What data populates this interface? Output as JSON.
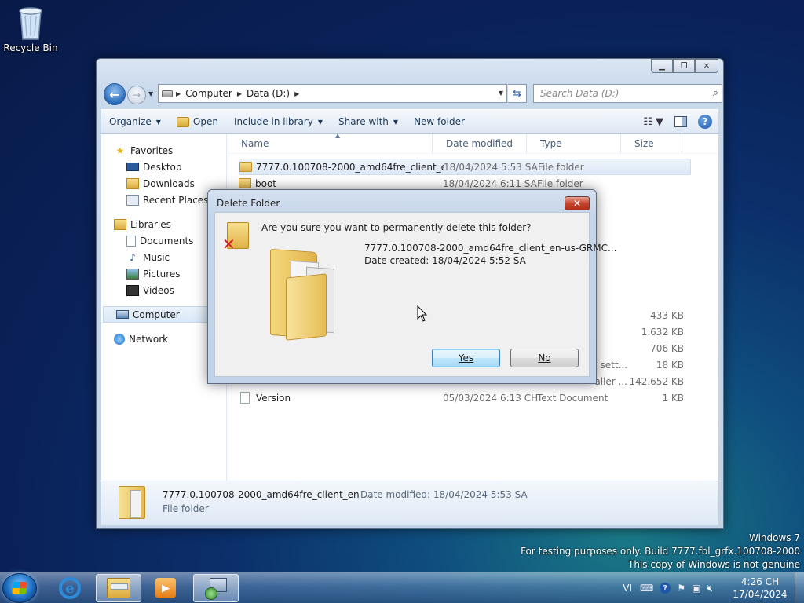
{
  "desktop": {
    "recycle_bin_label": "Recycle Bin",
    "watermark": {
      "line1": "Windows 7",
      "line2": "For testing purposes only. Build 7777.fbl_grfx.100708-2000",
      "line3": "This copy of Windows is not genuine"
    }
  },
  "explorer": {
    "address": {
      "segments": [
        "Computer",
        "Data (D:)"
      ]
    },
    "search_placeholder": "Search Data (D:)",
    "commands": {
      "organize": "Organize",
      "open": "Open",
      "include_in_library": "Include in library",
      "share_with": "Share with",
      "new_folder": "New folder"
    },
    "nav": {
      "favorites": "Favorites",
      "desktop": "Desktop",
      "downloads": "Downloads",
      "recent_places": "Recent Places",
      "libraries": "Libraries",
      "documents": "Documents",
      "music": "Music",
      "pictures": "Pictures",
      "videos": "Videos",
      "computer": "Computer",
      "network": "Network"
    },
    "columns": {
      "name": "Name",
      "date_modified": "Date modified",
      "type": "Type",
      "size": "Size"
    },
    "rows": [
      {
        "name": "7777.0.100708-2000_amd64fre_client_en-...",
        "date": "18/04/2024 5:53 SA",
        "type": "File folder",
        "size": ""
      },
      {
        "name": "boot",
        "date": "18/04/2024 6:11 SA",
        "type": "File folder",
        "size": ""
      }
    ],
    "partial_sizes": {
      "s1": "433 KB",
      "s2": "1.632 KB",
      "s3": "706 KB",
      "s4": "18 KB",
      "s5": "142.652 KB"
    },
    "partial_types": {
      "t1": "a sett...",
      "t2": "aller ..."
    },
    "version_row": {
      "name": "Version",
      "date": "05/03/2024 6:13 CH",
      "type": "Text Document",
      "size": "1 KB"
    },
    "details": {
      "name": "7777.0.100708-2000_amd64fre_client_en-...",
      "modified": "Date modified: 18/04/2024 5:53 SA",
      "type": "File folder"
    }
  },
  "dialog": {
    "title": "Delete Folder",
    "question": "Are you sure you want to permanently delete this folder?",
    "folder_name": "7777.0.100708-2000_amd64fre_client_en-us-GRMC...",
    "date_created": "Date created: 18/04/2024 5:52 SA",
    "yes_label": "Yes",
    "no_label": "No"
  },
  "taskbar": {
    "language": "VI",
    "time": "4:26 CH",
    "date": "17/04/2024"
  }
}
